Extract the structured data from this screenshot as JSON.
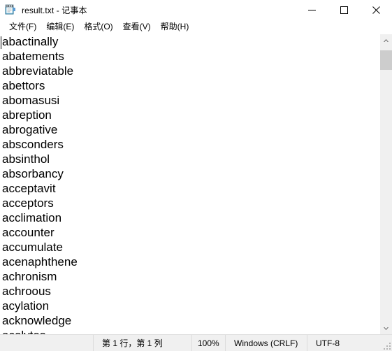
{
  "window": {
    "title": "result.txt - 记事本",
    "icon": "notepad-icon",
    "controls": {
      "minimize": "最小化",
      "maximize": "最大化",
      "close": "关闭"
    }
  },
  "menubar": {
    "items": [
      {
        "label": "文件(F)"
      },
      {
        "label": "编辑(E)"
      },
      {
        "label": "格式(O)"
      },
      {
        "label": "查看(V)"
      },
      {
        "label": "帮助(H)"
      }
    ]
  },
  "editor": {
    "lines": [
      "abactinally",
      "abatements",
      "abbreviatable",
      "abettors",
      "abomasusi",
      "abreption",
      "abrogative",
      "absconders",
      "absinthol",
      "absorbancy",
      "acceptavit",
      "acceptors",
      "acclimation",
      "accounter",
      "accumulate",
      "acenaphthene",
      "achronism",
      "achroous",
      "acylation",
      "acknowledge",
      "acolytes"
    ]
  },
  "scrollbar": {
    "up_arrow": "scroll-up",
    "down_arrow": "scroll-down"
  },
  "statusbar": {
    "position": "第 1 行，第 1 列",
    "zoom": "100%",
    "line_ending": "Windows (CRLF)",
    "encoding": "UTF-8"
  },
  "colors": {
    "window_bg": "#ffffff",
    "statusbar_bg": "#f0f0f0",
    "scrollbar_track": "#f0f0f0",
    "scrollbar_thumb": "#cdcdcd",
    "text": "#000000"
  }
}
